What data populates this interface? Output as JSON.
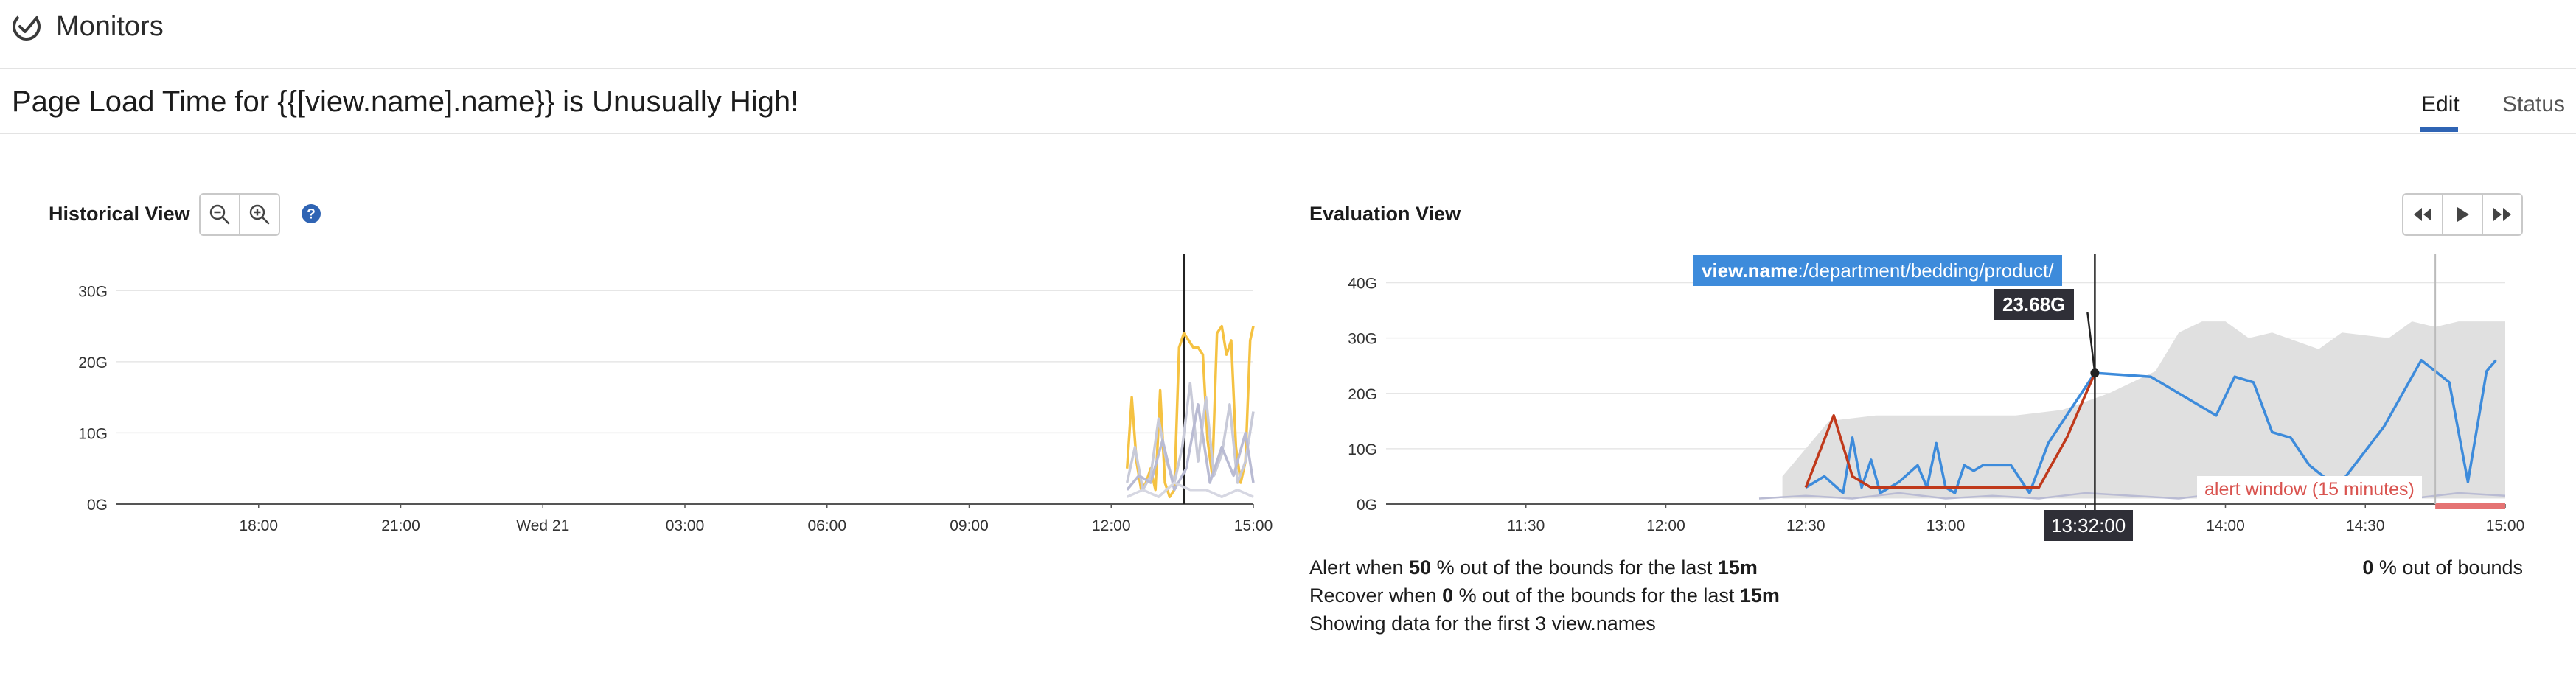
{
  "app": {
    "title": "Monitors",
    "icon": "monitor-check-icon"
  },
  "page": {
    "title": "Page Load Time for {{[view.name].name}} is Unusually High!"
  },
  "tabs": [
    {
      "label": "Edit",
      "active": true
    },
    {
      "label": "Status",
      "active": false
    }
  ],
  "historical": {
    "title": "Historical View",
    "buttons": [
      "zoom-out-icon",
      "zoom-in-icon"
    ],
    "help_icon": "question-circle-icon"
  },
  "evaluation": {
    "title": "Evaluation View",
    "buttons": [
      "rewind-icon",
      "play-icon",
      "fast-forward-icon"
    ],
    "tooltip_series_key": "view.name",
    "tooltip_series_value": ":/department/bedding/product/",
    "tooltip_value": "23.68G",
    "tooltip_time": "13:32:00",
    "alert_window_label": "alert window (15 minutes)",
    "alert_line": {
      "prefix": "Alert when ",
      "pct": "50",
      "middle": " % out of the bounds for the last ",
      "window": "15m"
    },
    "recover_line": {
      "prefix": "Recover when ",
      "pct": "0",
      "middle": " % out of the bounds for the last ",
      "window": "15m"
    },
    "showing_line": "Showing data for the first 3 view.names",
    "out_of_bounds": {
      "value": "0",
      "suffix": " % out of bounds"
    }
  },
  "colors": {
    "accent": "#2f64b4",
    "historical_series": [
      "#f5c242",
      "#f7d27a",
      "#b9bbd3",
      "#c8cad8",
      "#d6d7e2"
    ],
    "eval_series_blue": "#3d8bdb",
    "eval_series_red": "#c0391b",
    "bounds_band": "#e0e0e0",
    "alert_window": "#e57373"
  },
  "chart_data": [
    {
      "type": "line",
      "title": "Historical View",
      "x_ticks": [
        "18:00",
        "21:00",
        "Wed 21",
        "03:00",
        "06:00",
        "09:00",
        "12:00",
        "15:00"
      ],
      "y_ticks": [
        "0G",
        "10G",
        "20G",
        "30G"
      ],
      "ylim": [
        0,
        35
      ],
      "grid": true,
      "cursor_time": "13:32",
      "series": [
        {
          "color": "#f5c242",
          "x": [
            "12:20",
            "12:26",
            "12:32",
            "12:38",
            "12:44",
            "12:50",
            "12:56",
            "13:02",
            "13:08",
            "13:14",
            "13:20",
            "13:26",
            "13:32",
            "13:38",
            "13:44",
            "13:50",
            "13:56",
            "14:02",
            "14:08",
            "14:14",
            "14:20",
            "14:26",
            "14:32",
            "14:38",
            "14:44",
            "14:50",
            "14:56",
            "15:00"
          ],
          "y": [
            5,
            15,
            6,
            2,
            3,
            5,
            2,
            16,
            3,
            1,
            2,
            22,
            24,
            23,
            22,
            22,
            21,
            9,
            4,
            24,
            25,
            21,
            23,
            8,
            3,
            6,
            23,
            25
          ]
        },
        {
          "color": "#c8cad8",
          "x": [
            "12:20",
            "12:30",
            "12:40",
            "12:50",
            "13:00",
            "13:10",
            "13:20",
            "13:30",
            "13:40",
            "13:50",
            "14:00",
            "14:10",
            "14:20",
            "14:30",
            "14:40",
            "14:50",
            "15:00"
          ],
          "y": [
            3,
            8,
            2,
            4,
            12,
            6,
            3,
            8,
            17,
            6,
            15,
            4,
            7,
            14,
            3,
            6,
            13
          ]
        },
        {
          "color": "#b9bbd3",
          "x": [
            "12:20",
            "12:35",
            "12:50",
            "13:05",
            "13:20",
            "13:35",
            "13:50",
            "14:05",
            "14:20",
            "14:35",
            "14:50",
            "15:00"
          ],
          "y": [
            2,
            4,
            3,
            9,
            2,
            5,
            14,
            3,
            8,
            4,
            10,
            3
          ]
        },
        {
          "color": "#d6d7e2",
          "x": [
            "12:20",
            "12:40",
            "13:00",
            "13:20",
            "13:40",
            "14:00",
            "14:20",
            "14:40",
            "15:00"
          ],
          "y": [
            1,
            2,
            1,
            3,
            2,
            2,
            1,
            2,
            1
          ]
        }
      ]
    },
    {
      "type": "line",
      "title": "Evaluation View",
      "x_ticks": [
        "11:30",
        "12:00",
        "12:30",
        "13:00",
        "13:30",
        "14:00",
        "14:30",
        "15:00"
      ],
      "y_ticks": [
        "0G",
        "10G",
        "20G",
        "30G",
        "40G"
      ],
      "ylim": [
        0,
        45
      ],
      "grid": true,
      "cursor_time": "13:32",
      "bounds_upper": {
        "x": [
          "12:25",
          "12:35",
          "12:45",
          "13:00",
          "13:15",
          "13:25",
          "13:35",
          "13:45",
          "13:50",
          "13:55",
          "14:00",
          "14:05",
          "14:10",
          "14:20",
          "14:25",
          "14:35",
          "14:40",
          "14:45",
          "14:50",
          "15:00"
        ],
        "y": [
          5,
          15,
          16,
          16,
          16,
          17,
          20,
          24,
          31,
          33,
          33,
          30,
          31,
          28,
          31,
          30,
          33,
          32,
          33,
          33
        ]
      },
      "bounds_lower": {
        "x": [
          "12:25",
          "15:00"
        ],
        "y": [
          1,
          1
        ]
      },
      "series": [
        {
          "name": "view.name:/department/bedding/product/",
          "color": "#3d8bdb",
          "x": [
            "12:30",
            "12:34",
            "12:38",
            "12:40",
            "12:42",
            "12:44",
            "12:46",
            "12:50",
            "12:54",
            "12:56",
            "12:58",
            "13:00",
            "13:02",
            "13:04",
            "13:06",
            "13:08",
            "13:14",
            "13:18",
            "13:22",
            "13:32",
            "13:44",
            "13:58",
            "14:02",
            "14:06",
            "14:10",
            "14:14",
            "14:18",
            "14:24",
            "14:34",
            "14:42",
            "14:48",
            "14:52",
            "14:56",
            "14:58"
          ],
          "y": [
            3,
            5,
            2,
            12,
            3,
            8,
            2,
            4,
            7,
            3,
            11,
            3,
            2,
            7,
            6,
            7,
            7,
            2,
            11,
            23.68,
            23,
            16,
            23,
            22,
            13,
            12,
            7,
            3,
            14,
            26,
            22,
            4,
            24,
            26
          ]
        },
        {
          "color": "#c0391b",
          "x": [
            "12:30",
            "12:36",
            "12:40",
            "12:44",
            "13:20",
            "13:26",
            "13:32"
          ],
          "y": [
            3,
            16,
            5,
            3,
            3,
            12,
            23.68
          ]
        },
        {
          "color": "#b9bbd3",
          "x": [
            "12:20",
            "12:30",
            "12:40",
            "12:50",
            "13:00",
            "13:10",
            "13:20",
            "13:30",
            "13:40",
            "13:50",
            "14:00",
            "14:10",
            "14:20",
            "14:30",
            "14:40",
            "14:50",
            "15:00"
          ],
          "y": [
            1,
            1.5,
            1,
            2,
            1,
            1.5,
            1,
            2,
            1.5,
            1,
            2,
            1,
            1.5,
            2,
            1,
            2,
            1.5
          ]
        }
      ],
      "alert_window": {
        "start": "14:45",
        "end": "15:00",
        "label": "alert window (15 minutes)"
      }
    }
  ]
}
